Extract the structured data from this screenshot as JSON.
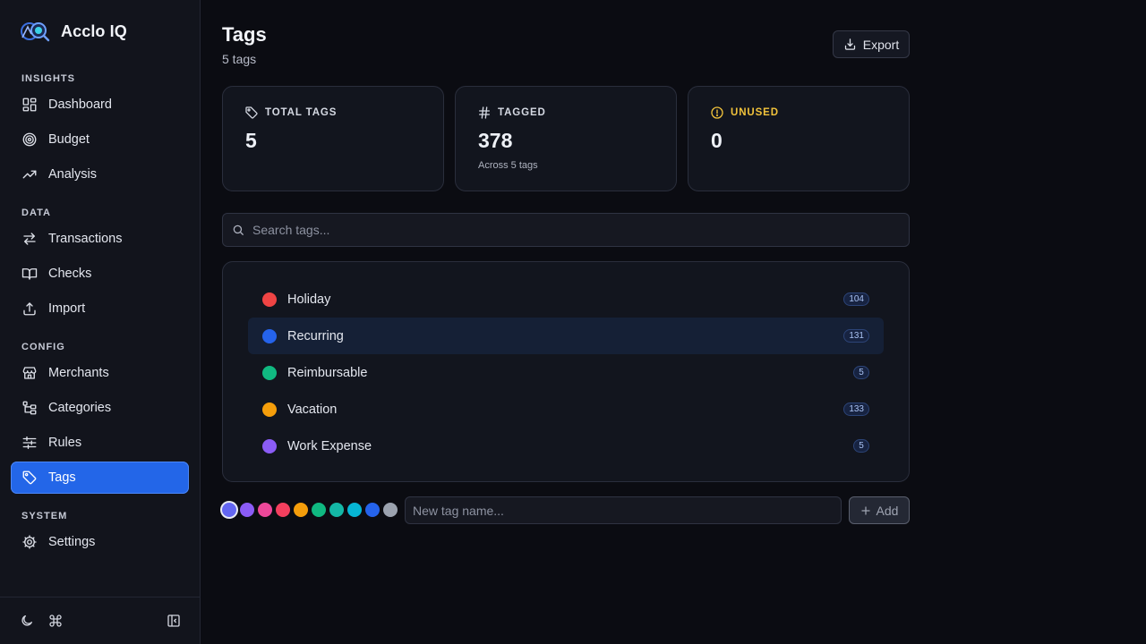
{
  "app": {
    "name": "Acclo IQ"
  },
  "sidebar": {
    "sections": [
      {
        "label": "INSIGHTS",
        "items": [
          {
            "label": "Dashboard",
            "icon": "dashboard-icon"
          },
          {
            "label": "Budget",
            "icon": "target-icon"
          },
          {
            "label": "Analysis",
            "icon": "trending-up-icon"
          }
        ]
      },
      {
        "label": "DATA",
        "items": [
          {
            "label": "Transactions",
            "icon": "arrows-exchange-icon"
          },
          {
            "label": "Checks",
            "icon": "book-open-icon"
          },
          {
            "label": "Import",
            "icon": "upload-icon"
          }
        ]
      },
      {
        "label": "CONFIG",
        "items": [
          {
            "label": "Merchants",
            "icon": "store-icon"
          },
          {
            "label": "Categories",
            "icon": "hierarchy-icon"
          },
          {
            "label": "Rules",
            "icon": "sliders-icon"
          },
          {
            "label": "Tags",
            "icon": "tag-icon",
            "active": true
          }
        ]
      },
      {
        "label": "SYSTEM",
        "items": [
          {
            "label": "Settings",
            "icon": "gear-icon"
          }
        ]
      }
    ]
  },
  "header": {
    "title": "Tags",
    "subtitle": "5 tags",
    "export_label": "Export"
  },
  "stats": {
    "total": {
      "label": "TOTAL TAGS",
      "value": "5"
    },
    "tagged": {
      "label": "TAGGED",
      "value": "378",
      "note": "Across 5 tags"
    },
    "unused": {
      "label": "UNUSED",
      "value": "0",
      "color": "#f2c33b"
    }
  },
  "search": {
    "placeholder": "Search tags...",
    "value": ""
  },
  "tags": [
    {
      "name": "Holiday",
      "count": "104",
      "color": "#ef4444"
    },
    {
      "name": "Recurring",
      "count": "131",
      "color": "#2563eb"
    },
    {
      "name": "Reimbursable",
      "count": "5",
      "color": "#10b981"
    },
    {
      "name": "Vacation",
      "count": "133",
      "color": "#f59e0b"
    },
    {
      "name": "Work Expense",
      "count": "5",
      "color": "#8b5cf6"
    }
  ],
  "new_tag": {
    "placeholder": "New tag name...",
    "value": "",
    "add_label": "Add",
    "palette": [
      "#6366f1",
      "#8b5cf6",
      "#ec4899",
      "#f43f5e",
      "#f59e0b",
      "#10b981",
      "#14b8a6",
      "#06b6d4",
      "#2563eb",
      "#9ca3af"
    ]
  },
  "colors": {
    "accent": "#2366e8",
    "background": "#0b0c12",
    "sidebar": "#12141c"
  }
}
